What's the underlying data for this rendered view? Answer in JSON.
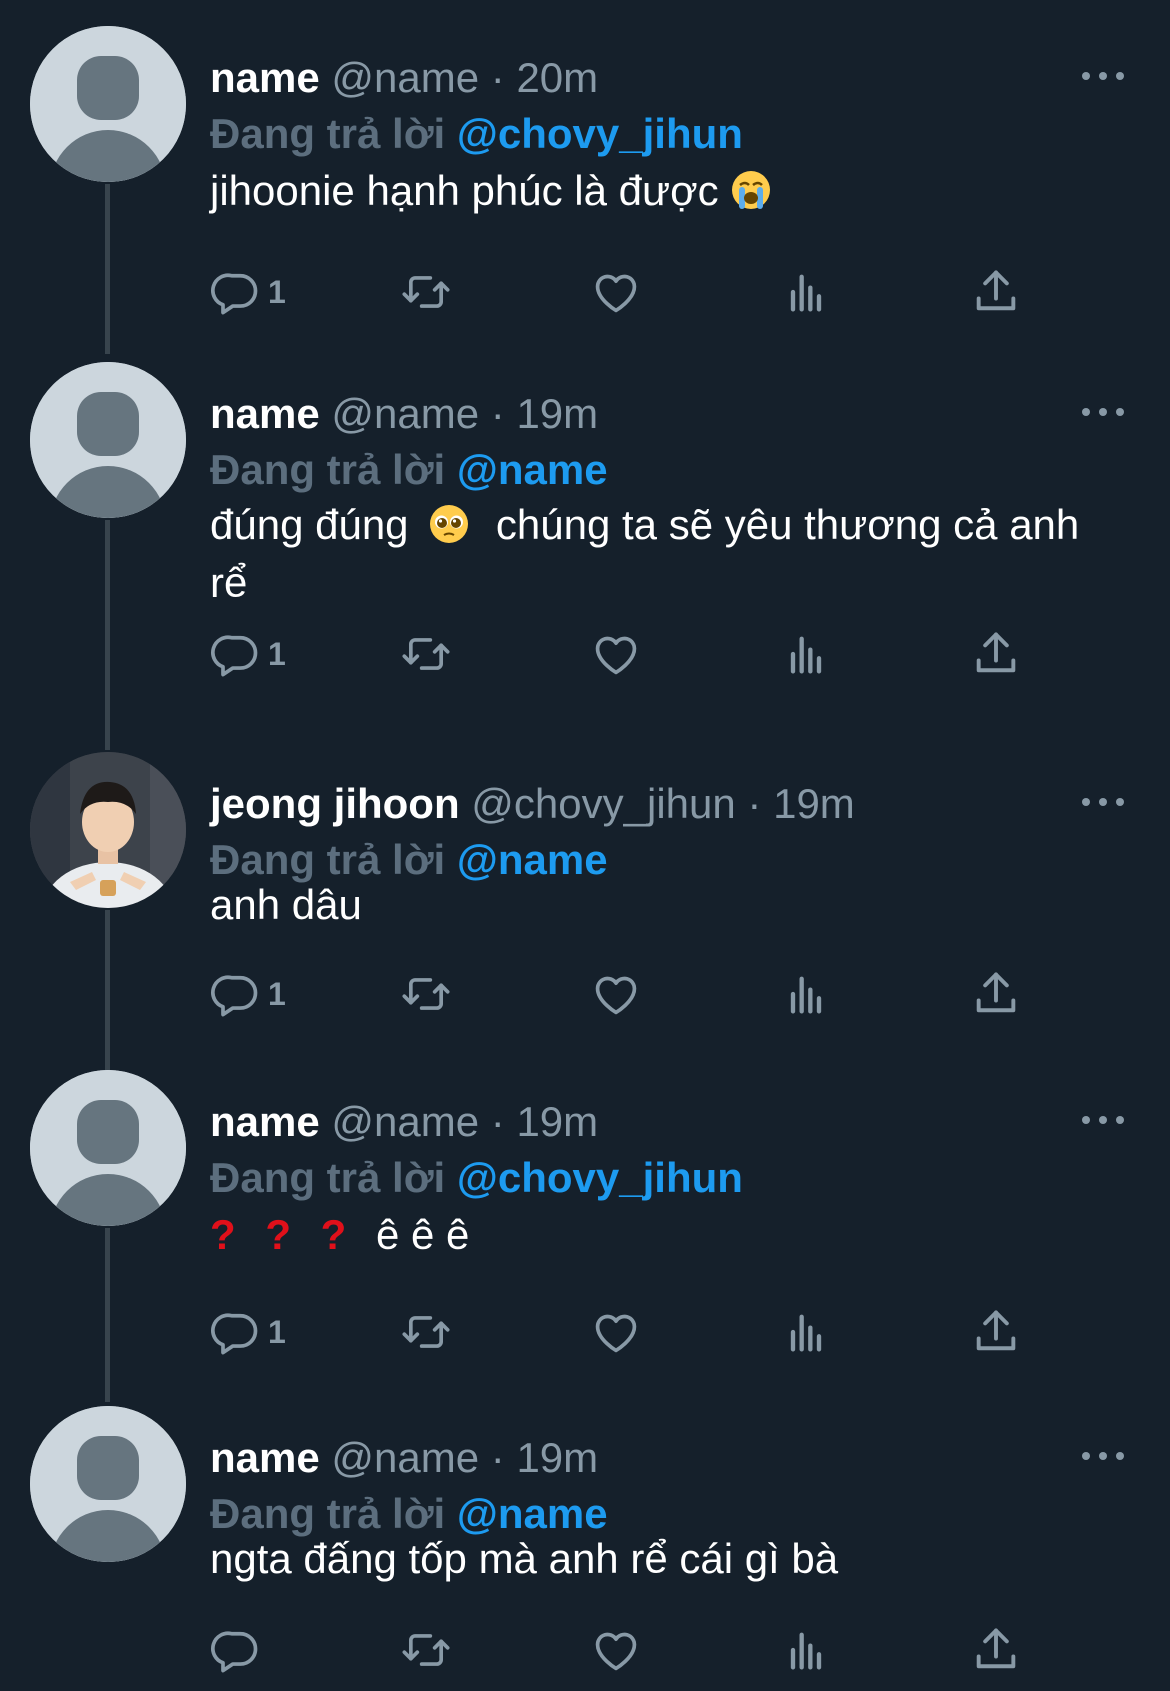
{
  "colors": {
    "background": "#15202b",
    "mention": "#1d9bf0",
    "muted": "#8899a6",
    "replying_label": "#5c6e7e",
    "thread_line": "#38444d",
    "question_mark": "#e0101a"
  },
  "tweets": [
    {
      "display_name": "name",
      "handle": "@name",
      "separator": "·",
      "time": "20m",
      "replying_label": "Đang trả lời",
      "replying_to": "@chovy_jihun",
      "text": "jihoonie hạnh phúc là được",
      "emoji": "loudly-crying-face",
      "reply_count": "1",
      "avatar": "default-avatar"
    },
    {
      "display_name": "name",
      "handle": "@name",
      "separator": "·",
      "time": "19m",
      "replying_label": "Đang trả lời",
      "replying_to": "@name",
      "text_part1": "đúng đúng",
      "text_part2": "chúng ta sẽ yêu thương cả anh rể",
      "emoji": "pleading-face",
      "reply_count": "1",
      "avatar": "default-avatar"
    },
    {
      "display_name": "jeong jihoon",
      "handle": "@chovy_jihun",
      "separator": "·",
      "time": "19m",
      "replying_label": "Đang trả lời",
      "replying_to": "@name",
      "text": "anh dâu",
      "reply_count": "1",
      "avatar": "profile-photo"
    },
    {
      "display_name": "name",
      "handle": "@name",
      "separator": "·",
      "time": "19m",
      "replying_label": "Đang trả lời",
      "replying_to": "@chovy_jihun",
      "question_marks": [
        "?",
        "?",
        "?"
      ],
      "text": "ê ê ê",
      "reply_count": "1",
      "avatar": "default-avatar"
    },
    {
      "display_name": "name",
      "handle": "@name",
      "separator": "·",
      "time": "19m",
      "replying_label": "Đang trả lời",
      "replying_to": "@name",
      "text": "ngta đấng tốp mà anh rể cái gì bà",
      "reply_count": "",
      "avatar": "default-avatar"
    }
  ],
  "action_icons": [
    "reply-icon",
    "retweet-icon",
    "like-icon",
    "views-icon",
    "share-icon"
  ]
}
